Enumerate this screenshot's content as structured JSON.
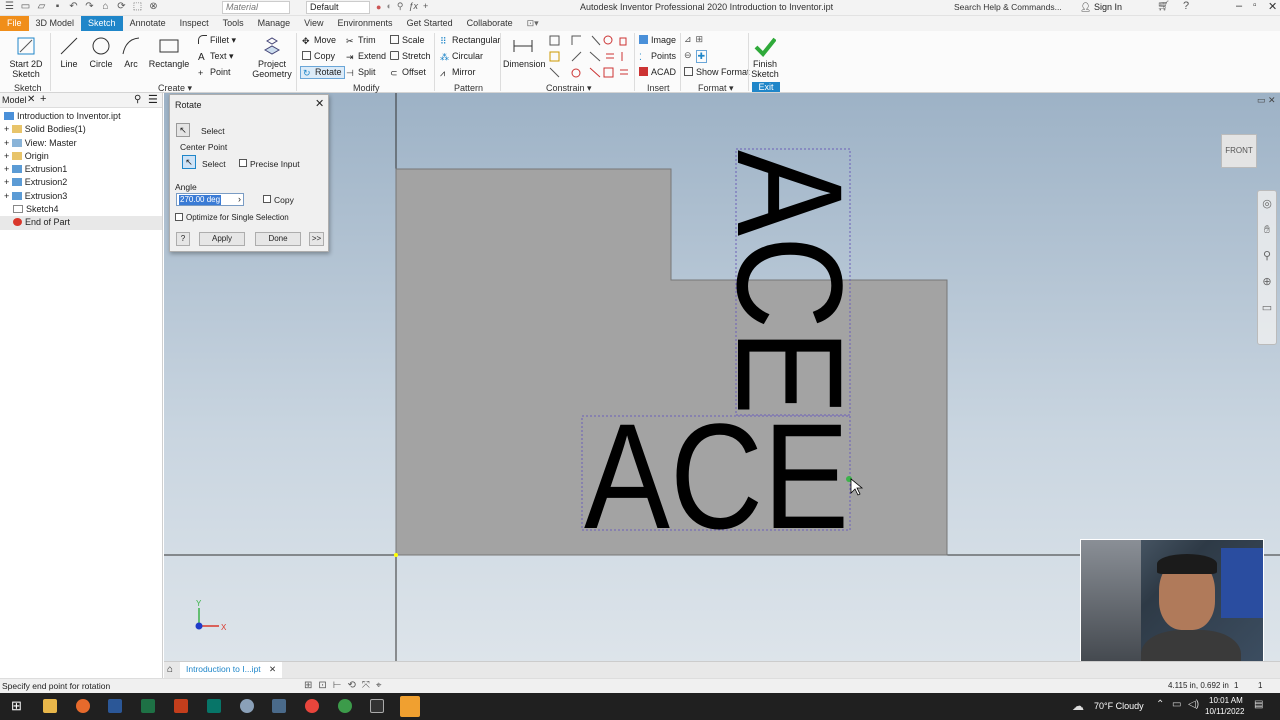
{
  "window": {
    "title": "Autodesk Inventor Professional 2020    Introduction to Inventor.ipt",
    "material": "Material",
    "appearance": "Default",
    "search_placeholder": "Search Help & Commands...",
    "sign_in": "Sign In"
  },
  "menu_tabs": [
    "File",
    "3D Model",
    "Sketch",
    "Annotate",
    "Inspect",
    "Tools",
    "Manage",
    "View",
    "Environments",
    "Get Started",
    "Collaborate"
  ],
  "ribbon": {
    "start_sketch": "Start 2D Sketch",
    "line": "Line",
    "circle": "Circle",
    "arc": "Arc",
    "rectangle": "Rectangle",
    "fillet": "Fillet",
    "text": "Text",
    "point": "Point",
    "project_geometry": "Project Geometry",
    "move": "Move",
    "copy": "Copy",
    "rotate": "Rotate",
    "trim": "Trim",
    "extend": "Extend",
    "split": "Split",
    "scale": "Scale",
    "stretch": "Stretch",
    "offset": "Offset",
    "rectangular": "Rectangular",
    "circular": "Circular",
    "mirror": "Mirror",
    "dimension": "Dimension",
    "image": "Image",
    "points": "Points",
    "acad": "ACAD",
    "show_format": "Show Format",
    "finish_sketch": "Finish Sketch",
    "groups": {
      "sketch": "Sketch",
      "create": "Create",
      "modify": "Modify",
      "pattern": "Pattern",
      "constrain": "Constrain",
      "insert": "Insert",
      "format": "Format",
      "exit": "Exit"
    }
  },
  "browser": {
    "tab": "Model",
    "items": [
      {
        "label": "Introduction to Inventor.ipt"
      },
      {
        "label": "Solid Bodies(1)"
      },
      {
        "label": "View: Master"
      },
      {
        "label": "Origin"
      },
      {
        "label": "Extrusion1"
      },
      {
        "label": "Extrusion2"
      },
      {
        "label": "Extrusion3"
      },
      {
        "label": "Sketch4"
      },
      {
        "label": "End of Part"
      }
    ]
  },
  "dialog": {
    "title": "Rotate",
    "select": "Select",
    "center_point": "Center Point",
    "center_select": "Select",
    "precise_input": "Precise Input",
    "angle_label": "Angle",
    "angle_value": "270.00 deg",
    "copy": "Copy",
    "optimize": "Optimize for Single Selection",
    "apply": "Apply",
    "done": "Done",
    "more": ">>"
  },
  "viewport": {
    "text_horizontal": "ACE",
    "text_vertical": "ACE",
    "viewcube": "FRONT",
    "axis_x": "X",
    "axis_y": "Y"
  },
  "doc_tab": "Introduction to I...ipt",
  "status": {
    "prompt": "Specify end point for rotation",
    "coords": "4.115 in, 0.692 in",
    "count": "1",
    "count2": "1"
  },
  "taskbar": {
    "weather": "70°F  Cloudy",
    "time": "10:01 AM",
    "date": "10/11/2022"
  },
  "colors": {
    "accent": "#1f86c9",
    "file_tab": "#f08e1a",
    "finish_green": "#2faa3a"
  }
}
